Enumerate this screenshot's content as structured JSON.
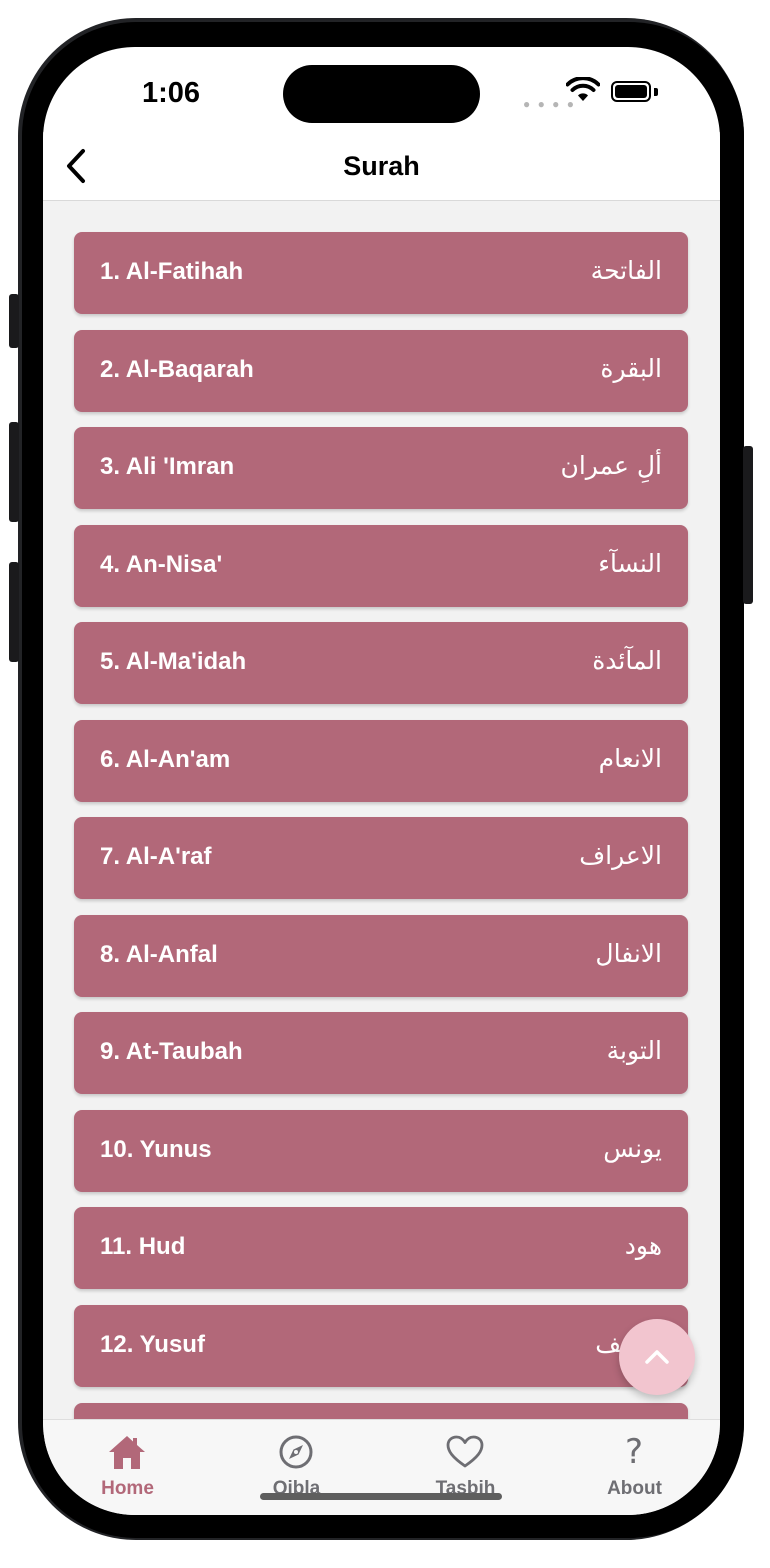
{
  "status_bar": {
    "time": "1:06"
  },
  "nav": {
    "title": "Surah"
  },
  "surahs": [
    {
      "en": "1. Al-Fatihah",
      "ar": "الفاتحة"
    },
    {
      "en": "2. Al-Baqarah",
      "ar": "البقرة"
    },
    {
      "en": "3. Ali 'Imran",
      "ar": "ألِ عمران"
    },
    {
      "en": "4. An-Nisa'",
      "ar": "النسآء"
    },
    {
      "en": "5. Al-Ma'idah",
      "ar": "المآئدة"
    },
    {
      "en": "6. Al-An'am",
      "ar": "الانعام"
    },
    {
      "en": "7. Al-A'raf",
      "ar": "الاعراف"
    },
    {
      "en": "8. Al-Anfal",
      "ar": "الانفال"
    },
    {
      "en": "9. At-Taubah",
      "ar": "التوبة"
    },
    {
      "en": "10. Yunus",
      "ar": "يونس"
    },
    {
      "en": "11. Hud",
      "ar": "هود"
    },
    {
      "en": "12. Yusuf",
      "ar": "يوسف"
    },
    {
      "en": "",
      "ar": ""
    }
  ],
  "tabs": [
    {
      "label": "Home",
      "icon": "home-icon",
      "active": true
    },
    {
      "label": "Qibla",
      "icon": "compass-icon",
      "active": false
    },
    {
      "label": "Tasbih",
      "icon": "heart-icon",
      "active": false
    },
    {
      "label": "About",
      "icon": "question-icon",
      "active": false
    }
  ],
  "colors": {
    "row_bg": "#b26879",
    "active_tab": "#b26879",
    "inactive_tab": "#6e6e73",
    "fab_bg": "#f2c5cf",
    "list_bg": "#f2f2f2"
  }
}
